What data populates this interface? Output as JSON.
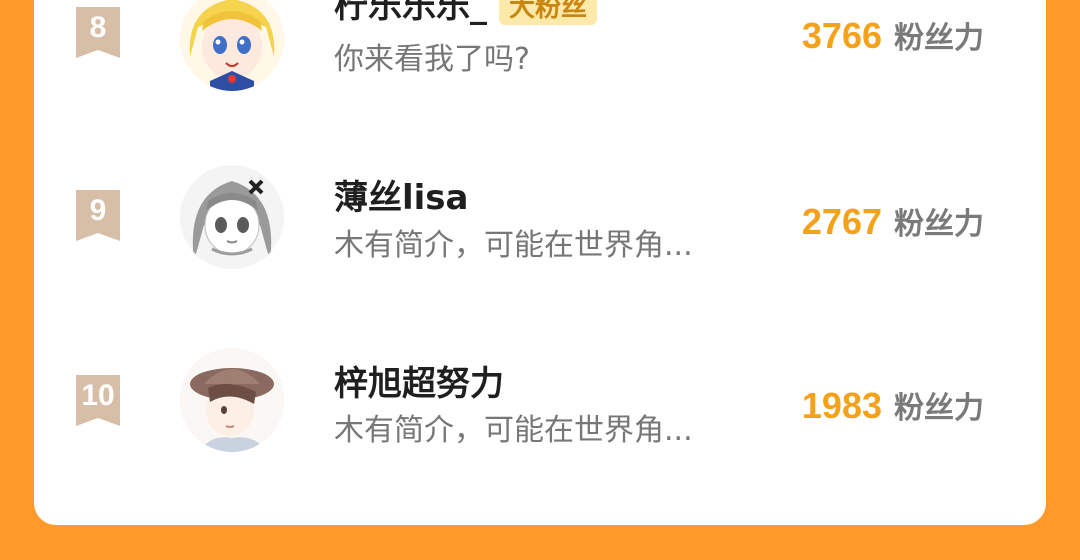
{
  "colors": {
    "background": "#ff9a2a",
    "card": "#ffffff",
    "score": "#f4a21a",
    "badge": "#d7bfa7"
  },
  "rows": [
    {
      "rank": "8",
      "name": "柠乐乐乐_",
      "tag": "大粉丝",
      "intro": "你来看我了吗?",
      "score": "3766",
      "unit": "粉丝力",
      "avatar_icon": "anime-girl-avatar-icon"
    },
    {
      "rank": "9",
      "name": "薄丝lisa",
      "intro": "木有简介，可能在世界角...",
      "score": "2767",
      "unit": "粉丝力",
      "avatar_icon": "anime-girl-avatar-icon"
    },
    {
      "rank": "10",
      "name": "梓旭超努力",
      "intro": "木有简介，可能在世界角...",
      "score": "1983",
      "unit": "粉丝力",
      "avatar_icon": "anime-boy-hat-avatar-icon"
    }
  ]
}
